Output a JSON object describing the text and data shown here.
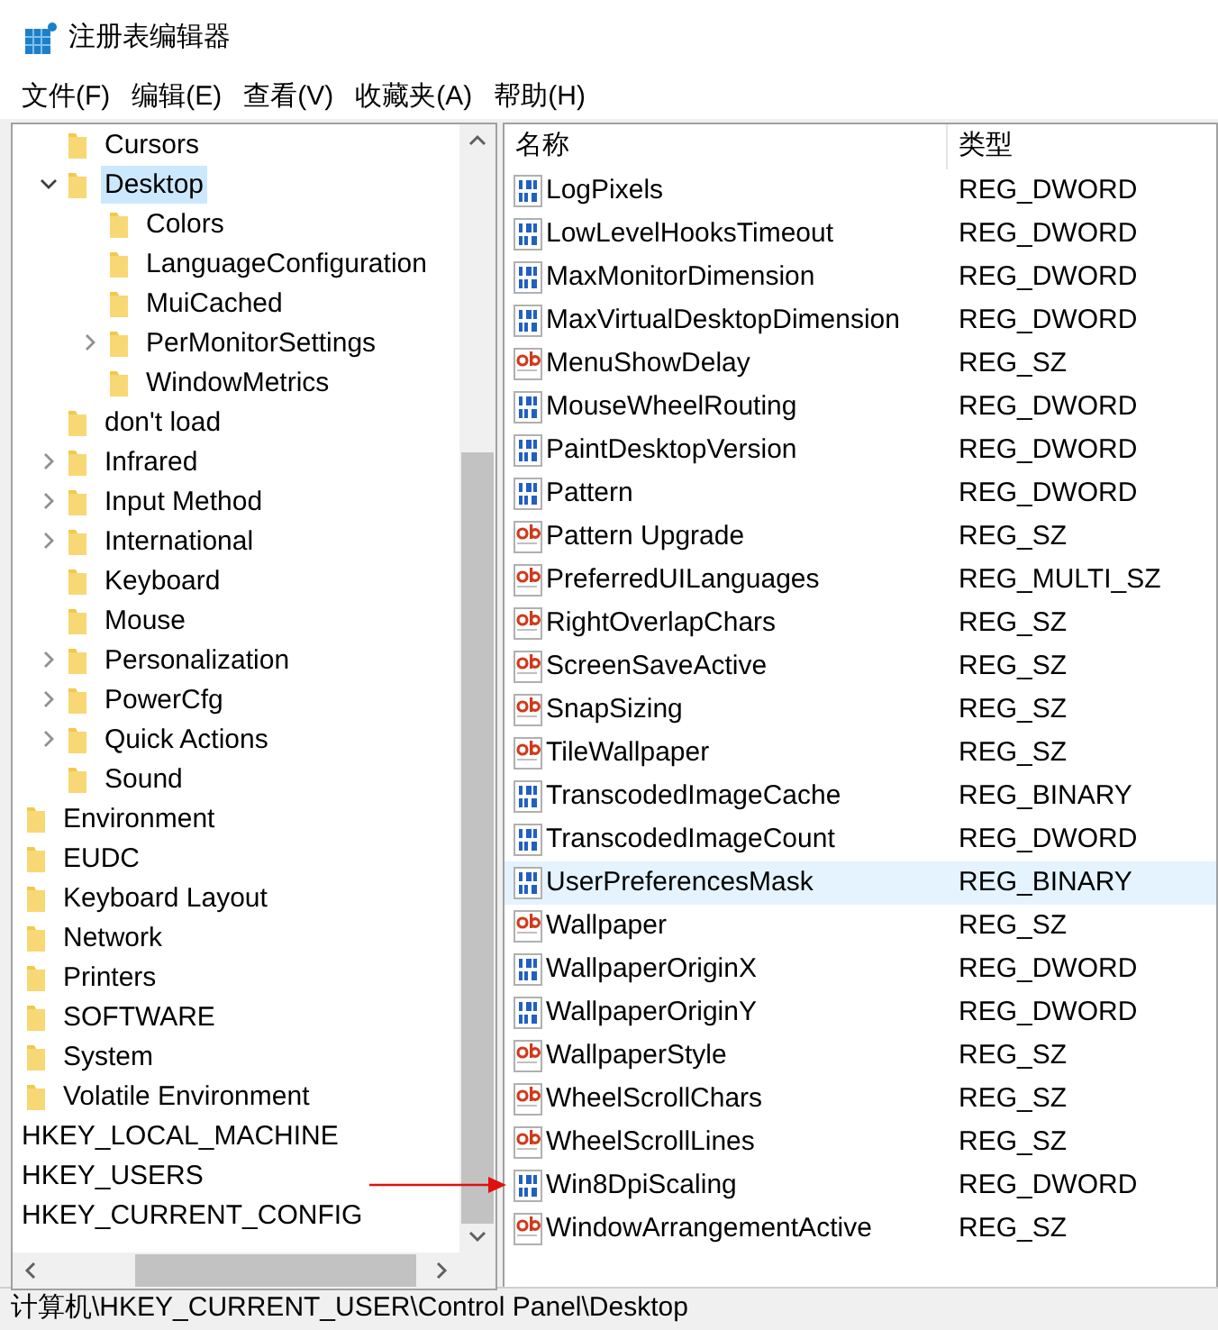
{
  "window": {
    "title": "注册表编辑器"
  },
  "menu": [
    "文件(F)",
    "编辑(E)",
    "查看(V)",
    "收藏夹(A)",
    "帮助(H)"
  ],
  "tree": [
    {
      "children": [
        {
          "children": [
            {
              "label": "Cursors",
              "kind": "leaf",
              "selected": false
            },
            {
              "label": "Desktop",
              "kind": "expanded",
              "selected": true,
              "children": [
                {
                  "label": "Colors",
                  "kind": "leaf",
                  "selected": false
                },
                {
                  "label": "LanguageConfiguration",
                  "kind": "leaf",
                  "selected": false
                },
                {
                  "label": "MuiCached",
                  "kind": "leaf",
                  "selected": false
                },
                {
                  "label": "PerMonitorSettings",
                  "kind": "collapsed",
                  "selected": false
                },
                {
                  "label": "WindowMetrics",
                  "kind": "leaf",
                  "selected": false
                }
              ]
            },
            {
              "label": "don't load",
              "kind": "leaf",
              "selected": false
            },
            {
              "label": "Infrared",
              "kind": "collapsed",
              "selected": false
            },
            {
              "label": "Input Method",
              "kind": "collapsed",
              "selected": false
            },
            {
              "label": "International",
              "kind": "collapsed",
              "selected": false
            },
            {
              "label": "Keyboard",
              "kind": "leaf",
              "selected": false
            },
            {
              "label": "Mouse",
              "kind": "leaf",
              "selected": false
            },
            {
              "label": "Personalization",
              "kind": "collapsed",
              "selected": false
            },
            {
              "label": "PowerCfg",
              "kind": "collapsed",
              "selected": false
            },
            {
              "label": "Quick Actions",
              "kind": "collapsed",
              "selected": false
            },
            {
              "label": "Sound",
              "kind": "leaf",
              "selected": false
            }
          ]
        },
        {
          "label": "Environment",
          "selected": false
        },
        {
          "label": "EUDC",
          "selected": false
        },
        {
          "label": "Keyboard Layout",
          "selected": false
        },
        {
          "label": "Network",
          "selected": false
        },
        {
          "label": "Printers",
          "selected": false
        },
        {
          "label": "SOFTWARE",
          "selected": false
        },
        {
          "label": "System",
          "selected": false
        },
        {
          "label": "Volatile Environment",
          "selected": false
        }
      ]
    },
    {
      "label": "HKEY_LOCAL_MACHINE",
      "selected": false
    },
    {
      "label": "HKEY_USERS",
      "selected": false
    },
    {
      "label": "HKEY_CURRENT_CONFIG",
      "selected": false
    }
  ],
  "values": {
    "columns": [
      "名称",
      "类型"
    ],
    "rows": [
      {
        "name": "LogPixels",
        "type": "REG_DWORD",
        "kind": "binary",
        "selected": false
      },
      {
        "name": "LowLevelHooksTimeout",
        "type": "REG_DWORD",
        "kind": "binary",
        "selected": false
      },
      {
        "name": "MaxMonitorDimension",
        "type": "REG_DWORD",
        "kind": "binary",
        "selected": false
      },
      {
        "name": "MaxVirtualDesktopDimension",
        "type": "REG_DWORD",
        "kind": "binary",
        "selected": false
      },
      {
        "name": "MenuShowDelay",
        "type": "REG_SZ",
        "kind": "string",
        "selected": false
      },
      {
        "name": "MouseWheelRouting",
        "type": "REG_DWORD",
        "kind": "binary",
        "selected": false
      },
      {
        "name": "PaintDesktopVersion",
        "type": "REG_DWORD",
        "kind": "binary",
        "selected": false
      },
      {
        "name": "Pattern",
        "type": "REG_DWORD",
        "kind": "binary",
        "selected": false
      },
      {
        "name": "Pattern Upgrade",
        "type": "REG_SZ",
        "kind": "string",
        "selected": false
      },
      {
        "name": "PreferredUILanguages",
        "type": "REG_MULTI_SZ",
        "kind": "string",
        "selected": false
      },
      {
        "name": "RightOverlapChars",
        "type": "REG_SZ",
        "kind": "string",
        "selected": false
      },
      {
        "name": "ScreenSaveActive",
        "type": "REG_SZ",
        "kind": "string",
        "selected": false
      },
      {
        "name": "SnapSizing",
        "type": "REG_SZ",
        "kind": "string",
        "selected": false
      },
      {
        "name": "TileWallpaper",
        "type": "REG_SZ",
        "kind": "string",
        "selected": false
      },
      {
        "name": "TranscodedImageCache",
        "type": "REG_BINARY",
        "kind": "binary",
        "selected": false
      },
      {
        "name": "TranscodedImageCount",
        "type": "REG_DWORD",
        "kind": "binary",
        "selected": false
      },
      {
        "name": "UserPreferencesMask",
        "type": "REG_BINARY",
        "kind": "binary",
        "selected": true
      },
      {
        "name": "Wallpaper",
        "type": "REG_SZ",
        "kind": "string",
        "selected": false
      },
      {
        "name": "WallpaperOriginX",
        "type": "REG_DWORD",
        "kind": "binary",
        "selected": false
      },
      {
        "name": "WallpaperOriginY",
        "type": "REG_DWORD",
        "kind": "binary",
        "selected": false
      },
      {
        "name": "WallpaperStyle",
        "type": "REG_SZ",
        "kind": "string",
        "selected": false
      },
      {
        "name": "WheelScrollChars",
        "type": "REG_SZ",
        "kind": "string",
        "selected": false
      },
      {
        "name": "WheelScrollLines",
        "type": "REG_SZ",
        "kind": "string",
        "selected": false
      },
      {
        "name": "Win8DpiScaling",
        "type": "REG_DWORD",
        "kind": "binary",
        "selected": false
      },
      {
        "name": "WindowArrangementActive",
        "type": "REG_SZ",
        "kind": "string",
        "selected": false
      }
    ]
  },
  "annotations": [
    {
      "kind": "arrow",
      "color": "#e01010"
    }
  ],
  "status_bar": "计算机\\HKEY_CURRENT_USER\\Control Panel\\Desktop"
}
